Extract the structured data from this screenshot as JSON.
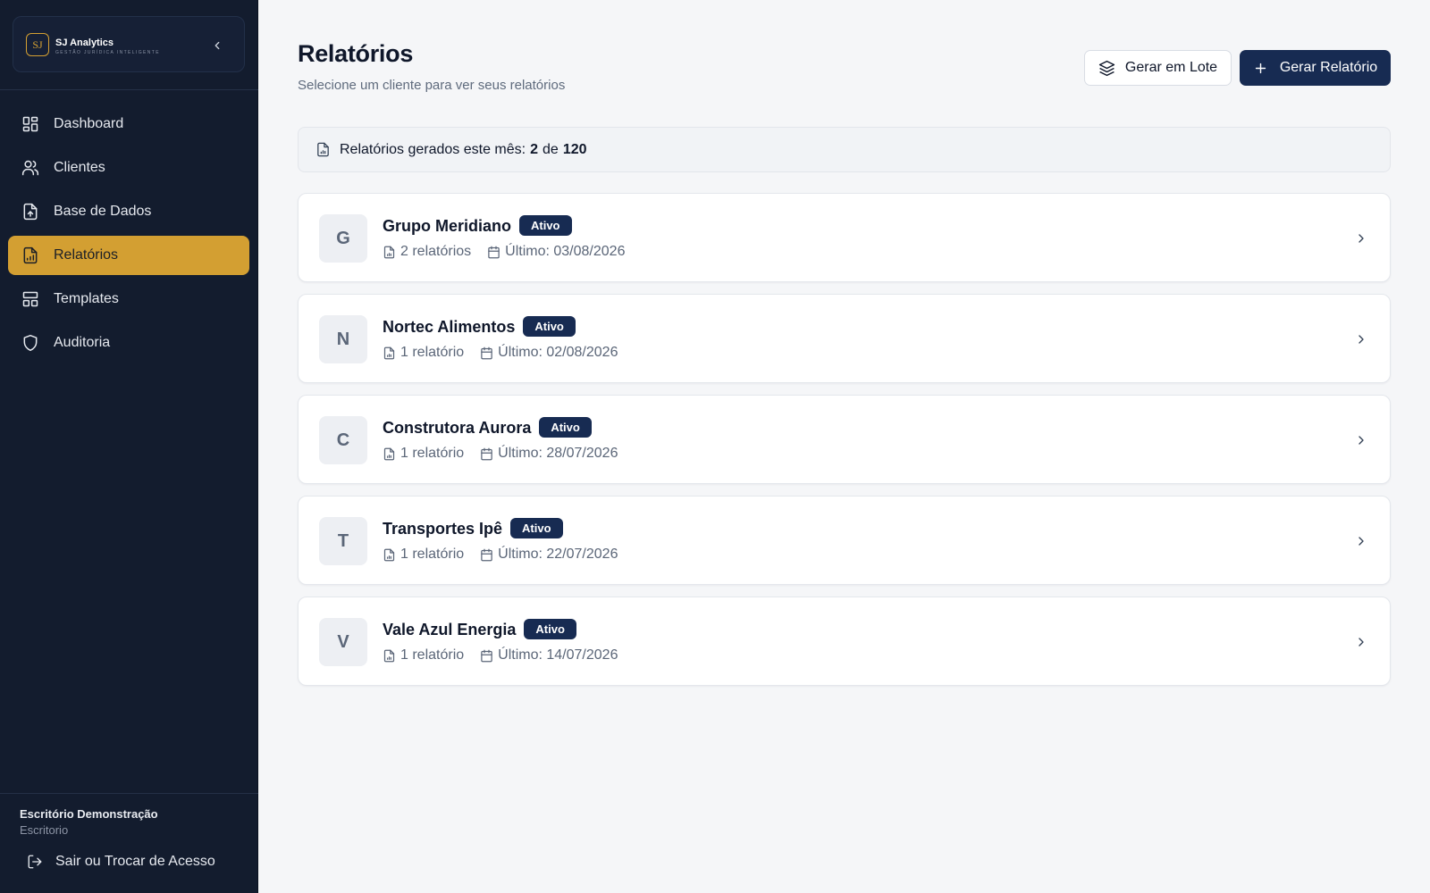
{
  "brand": {
    "logo_text": "SJ",
    "name": "SJ Analytics",
    "tagline": "GESTÃO JURÍDICA INTELIGENTE"
  },
  "sidebar": {
    "items": [
      {
        "label": "Dashboard",
        "icon": "dashboard-icon",
        "active": false
      },
      {
        "label": "Clientes",
        "icon": "users-icon",
        "active": false
      },
      {
        "label": "Base de Dados",
        "icon": "file-upload-icon",
        "active": false
      },
      {
        "label": "Relatórios",
        "icon": "file-chart-icon",
        "active": true
      },
      {
        "label": "Templates",
        "icon": "layout-icon",
        "active": false
      },
      {
        "label": "Auditoria",
        "icon": "shield-icon",
        "active": false
      }
    ],
    "footer": {
      "office_name": "Escritório Demonstração",
      "office_type": "Escritorio",
      "logout_label": "Sair ou Trocar de Acesso"
    }
  },
  "header": {
    "title": "Relatórios",
    "subtitle": "Selecione um cliente para ver seus relatórios",
    "batch_button": "Gerar em Lote",
    "generate_button": "Gerar Relatório"
  },
  "usage": {
    "label": "Relatórios gerados este mês:",
    "used": "2",
    "of_word": "de",
    "limit": "120"
  },
  "clients": [
    {
      "initial": "G",
      "name": "Grupo Meridiano",
      "status": "Ativo",
      "reports": "2 relatórios",
      "last": "Último: 03/08/2026"
    },
    {
      "initial": "N",
      "name": "Nortec Alimentos",
      "status": "Ativo",
      "reports": "1 relatório",
      "last": "Último: 02/08/2026"
    },
    {
      "initial": "C",
      "name": "Construtora Aurora",
      "status": "Ativo",
      "reports": "1 relatório",
      "last": "Último: 28/07/2026"
    },
    {
      "initial": "T",
      "name": "Transportes Ipê",
      "status": "Ativo",
      "reports": "1 relatório",
      "last": "Último: 22/07/2026"
    },
    {
      "initial": "V",
      "name": "Vale Azul Energia",
      "status": "Ativo",
      "reports": "1 relatório",
      "last": "Último: 14/07/2026"
    }
  ],
  "colors": {
    "sidebar_bg": "#131c2e",
    "accent_gold": "#d39f32",
    "primary_navy": "#172b52",
    "page_bg": "#f5f6f8"
  }
}
